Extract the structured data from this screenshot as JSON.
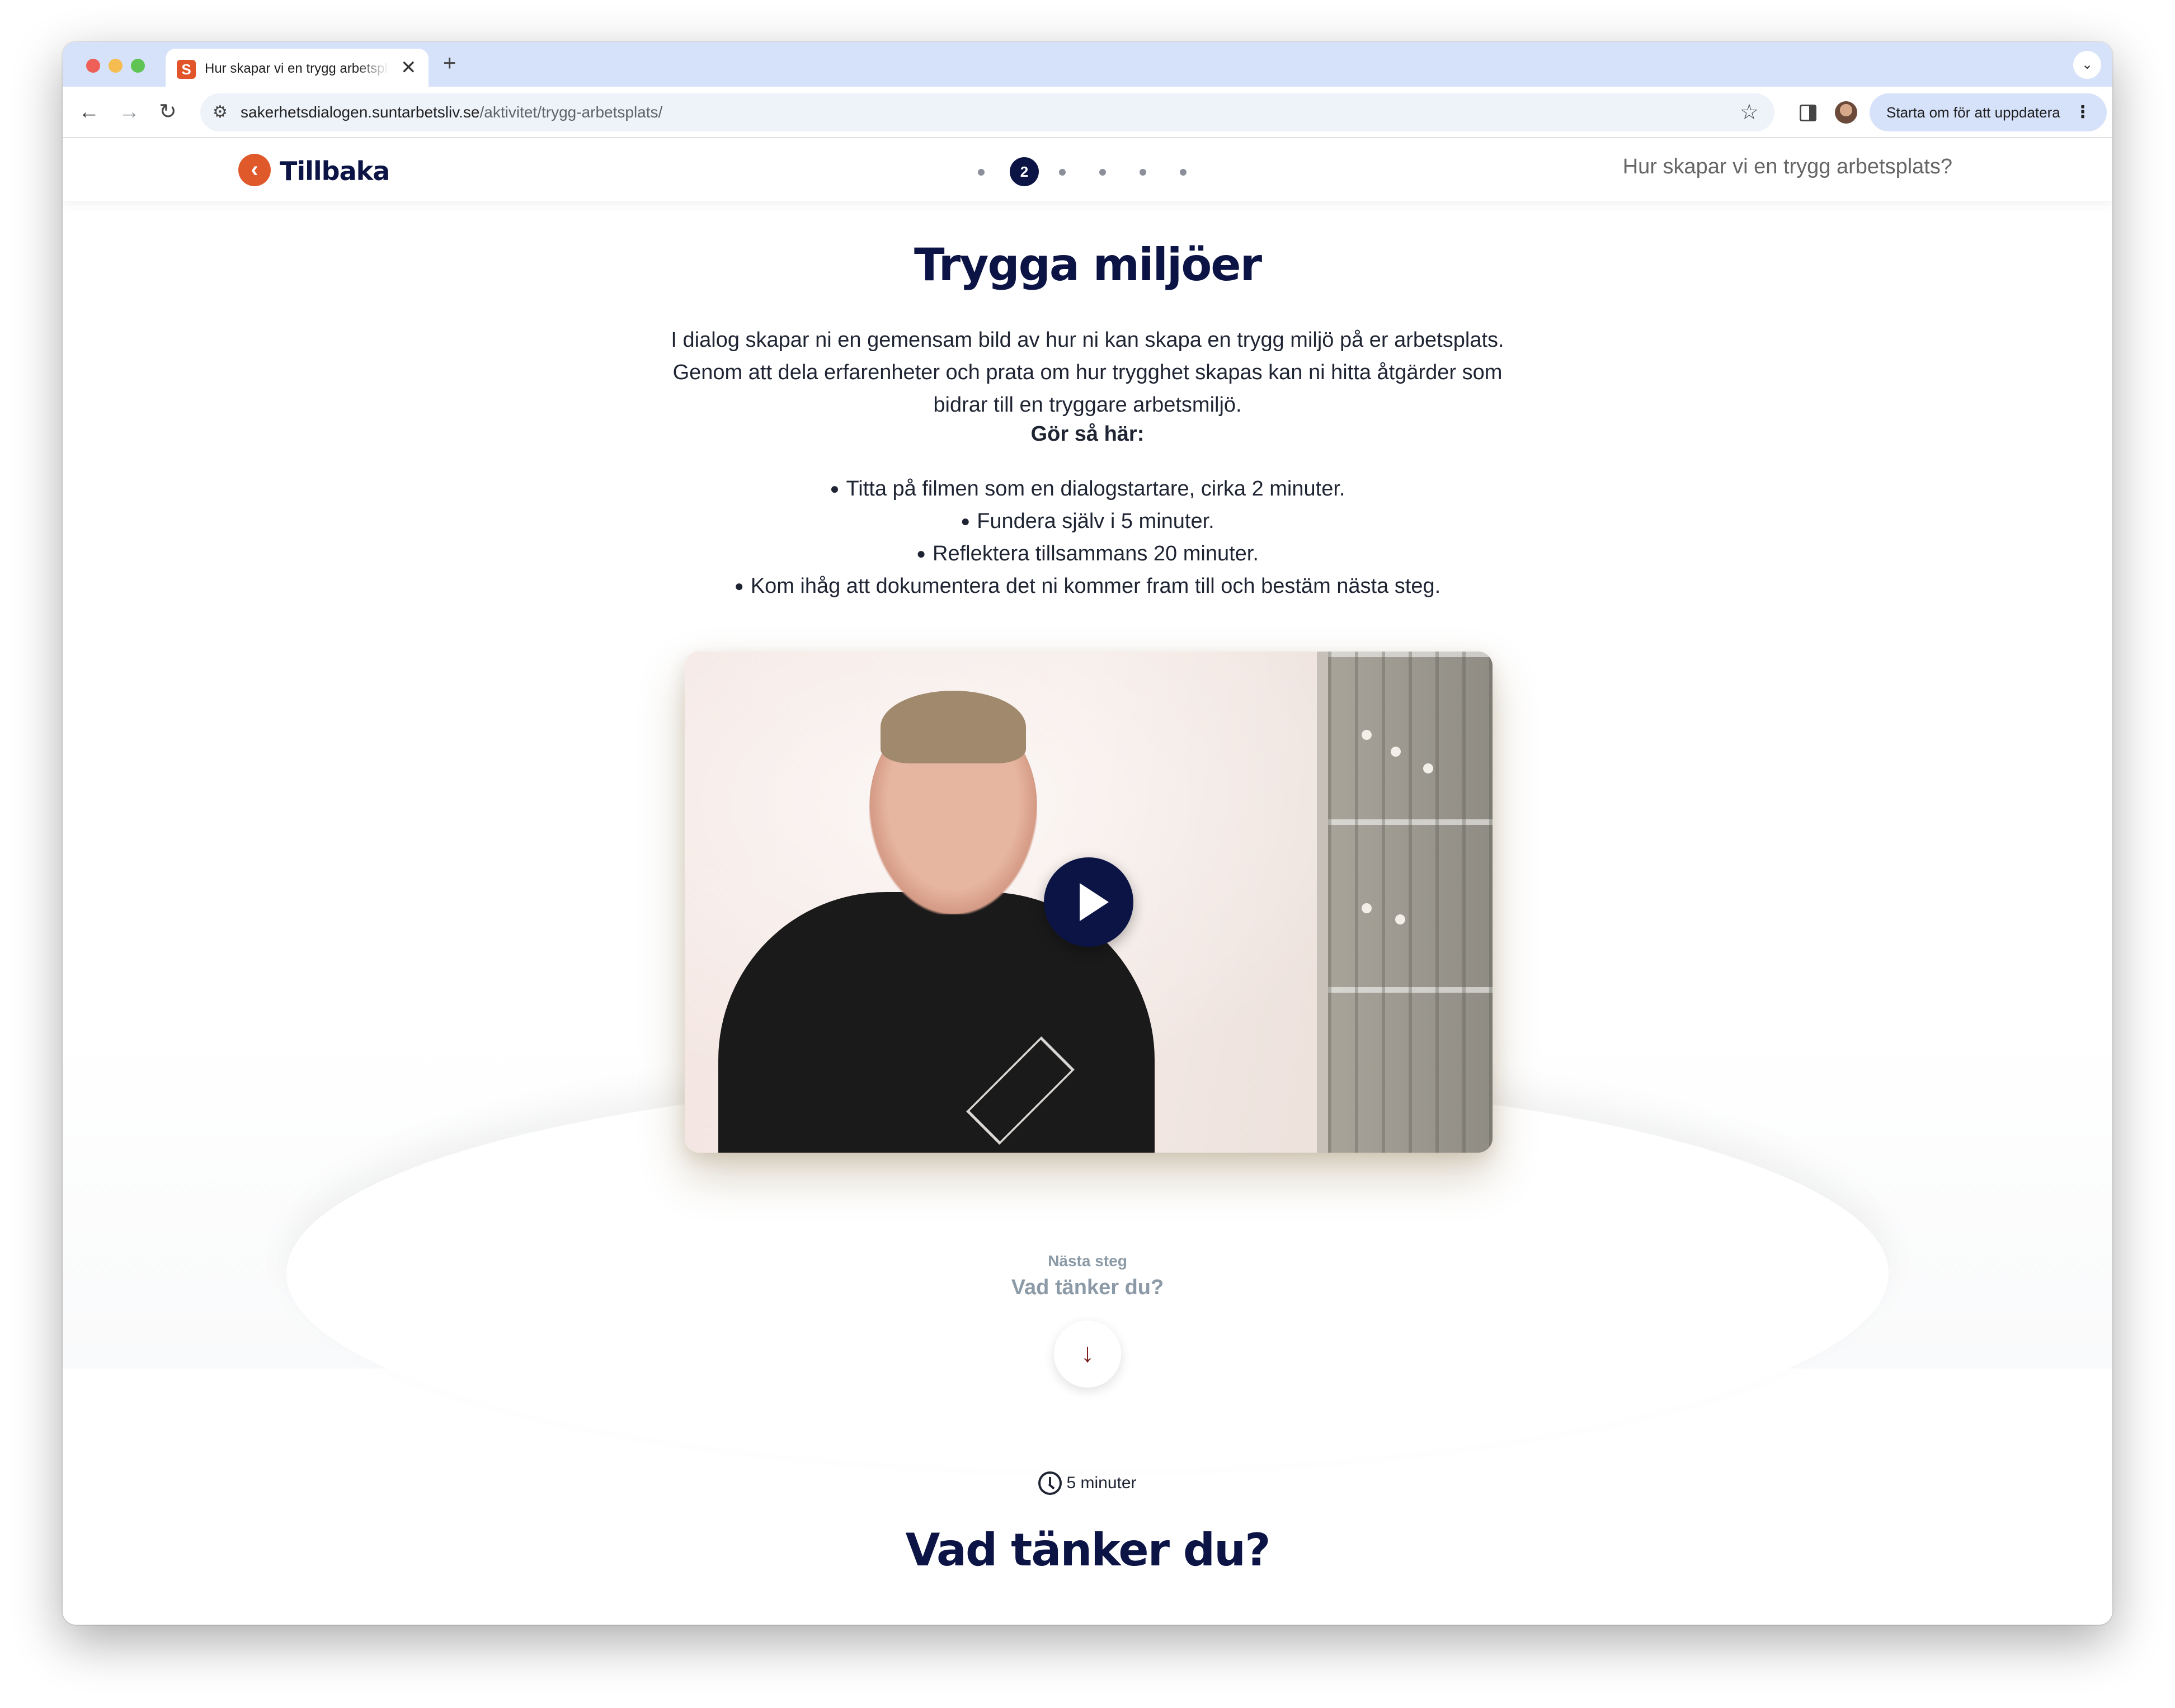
{
  "browser": {
    "tab_title": "Hur skapar vi en trygg arbetsplats?",
    "favicon_letter": "S",
    "close_glyph": "✕",
    "new_tab_glyph": "+",
    "url_host": "sakerhetsdialogen.suntarbetsliv.se",
    "url_path": "/aktivitet/trygg-arbetsplats/",
    "update_button_label": "Starta om för att uppdatera",
    "icons": {
      "back": "arrow-left-icon",
      "forward": "arrow-right-icon",
      "reload": "reload-icon",
      "bookmark": "star-icon",
      "side_panel": "side-panel-icon",
      "menu": "kebab-menu-icon"
    }
  },
  "header": {
    "back_label": "Tillbaka",
    "current_step": "2",
    "total_steps": 6,
    "activity_title": "Hur skapar vi en trygg arbetsplats?"
  },
  "main": {
    "title": "Trygga miljöer",
    "intro": "I dialog skapar ni en gemensam bild av hur ni kan skapa en trygg miljö på er arbetsplats. Genom att dela erfarenheter och prata om hur trygghet skapas kan ni hitta åtgärder som bidrar till en tryggare arbetsmiljö.",
    "howto_heading": "Gör så här:",
    "steps": [
      "Titta på filmen som en dialogstartare, cirka 2 minuter.",
      "Fundera själv i 5 minuter.",
      "Reflektera tillsammans 20 minuter.",
      "Kom ihåg att dokumentera det ni kommer fram till och bestäm nästa steg."
    ]
  },
  "next": {
    "label": "Nästa steg",
    "title": "Vad tänker du?"
  },
  "section": {
    "duration": "5 minuter",
    "title": "Vad tänker du?"
  },
  "colors": {
    "brand_navy": "#0b1444",
    "brand_orange": "#e0592a",
    "muted_text": "#8b9aa6"
  }
}
